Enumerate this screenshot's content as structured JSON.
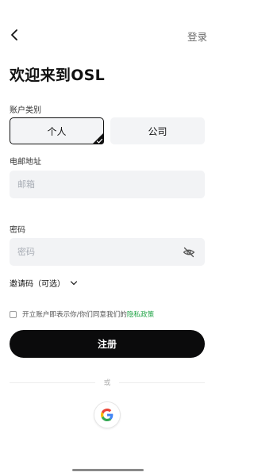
{
  "header": {
    "back_icon": "chevron-left-icon",
    "login_label": "登录"
  },
  "title": "欢迎来到OSL",
  "account_type": {
    "label": "账户类别",
    "options": [
      "个人",
      "公司"
    ],
    "selected": "个人"
  },
  "email": {
    "label": "电邮地址",
    "placeholder": "邮箱",
    "value": ""
  },
  "password": {
    "label": "密码",
    "placeholder": "密码",
    "value": "",
    "toggle_icon": "eye-off-icon"
  },
  "invite": {
    "label": "邀请码（可选）",
    "icon": "chevron-down-icon"
  },
  "agreement": {
    "checked": false,
    "text": "开立账户即表示你/你们同意我们的",
    "link_text": "隐私政策",
    "link_color": "#22a447"
  },
  "signup_button": {
    "label": "注册",
    "color": "#0b0b0c"
  },
  "divider": {
    "label": "或"
  },
  "social": {
    "google_icon": "google-icon"
  }
}
